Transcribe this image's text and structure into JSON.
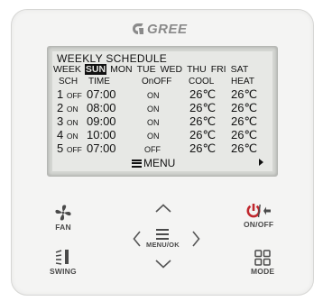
{
  "brand": {
    "name": "GREE"
  },
  "screen": {
    "title": "WEEKLY SCHEDULE",
    "week_label": "WEEK",
    "days": [
      "SUN",
      "MON",
      "TUE",
      "WED",
      "THU",
      "FRI",
      "SAT"
    ],
    "selected_day": "SUN",
    "columns": [
      "SCH",
      "TIME",
      "OnOFF",
      "COOL",
      "HEAT"
    ],
    "rows": [
      {
        "num": "1",
        "state": "OFF",
        "time": "07:00",
        "onoff": "ON",
        "cool": "26℃",
        "heat": "26℃"
      },
      {
        "num": "2",
        "state": "ON",
        "time": "08:00",
        "onoff": "ON",
        "cool": "26℃",
        "heat": "26℃"
      },
      {
        "num": "3",
        "state": "ON",
        "time": "09:00",
        "onoff": "ON",
        "cool": "26℃",
        "heat": "26℃"
      },
      {
        "num": "4",
        "state": "ON",
        "time": "10:00",
        "onoff": "ON",
        "cool": "26℃",
        "heat": "26℃"
      },
      {
        "num": "5",
        "state": "OFF",
        "time": "07:00",
        "onoff": "OFF",
        "cool": "26℃",
        "heat": "26℃"
      }
    ],
    "menu_label": "MENU"
  },
  "buttons": {
    "fan": "FAN",
    "onoff": "ON/OFF",
    "menu_ok": "MENU/OK",
    "swing": "SWING",
    "mode": "MODE"
  },
  "colors": {
    "panel": "#f4f4f3",
    "lcd_bg": "#e7e8e5",
    "icon": "#4a4a4a",
    "power_red": "#c0272d"
  }
}
